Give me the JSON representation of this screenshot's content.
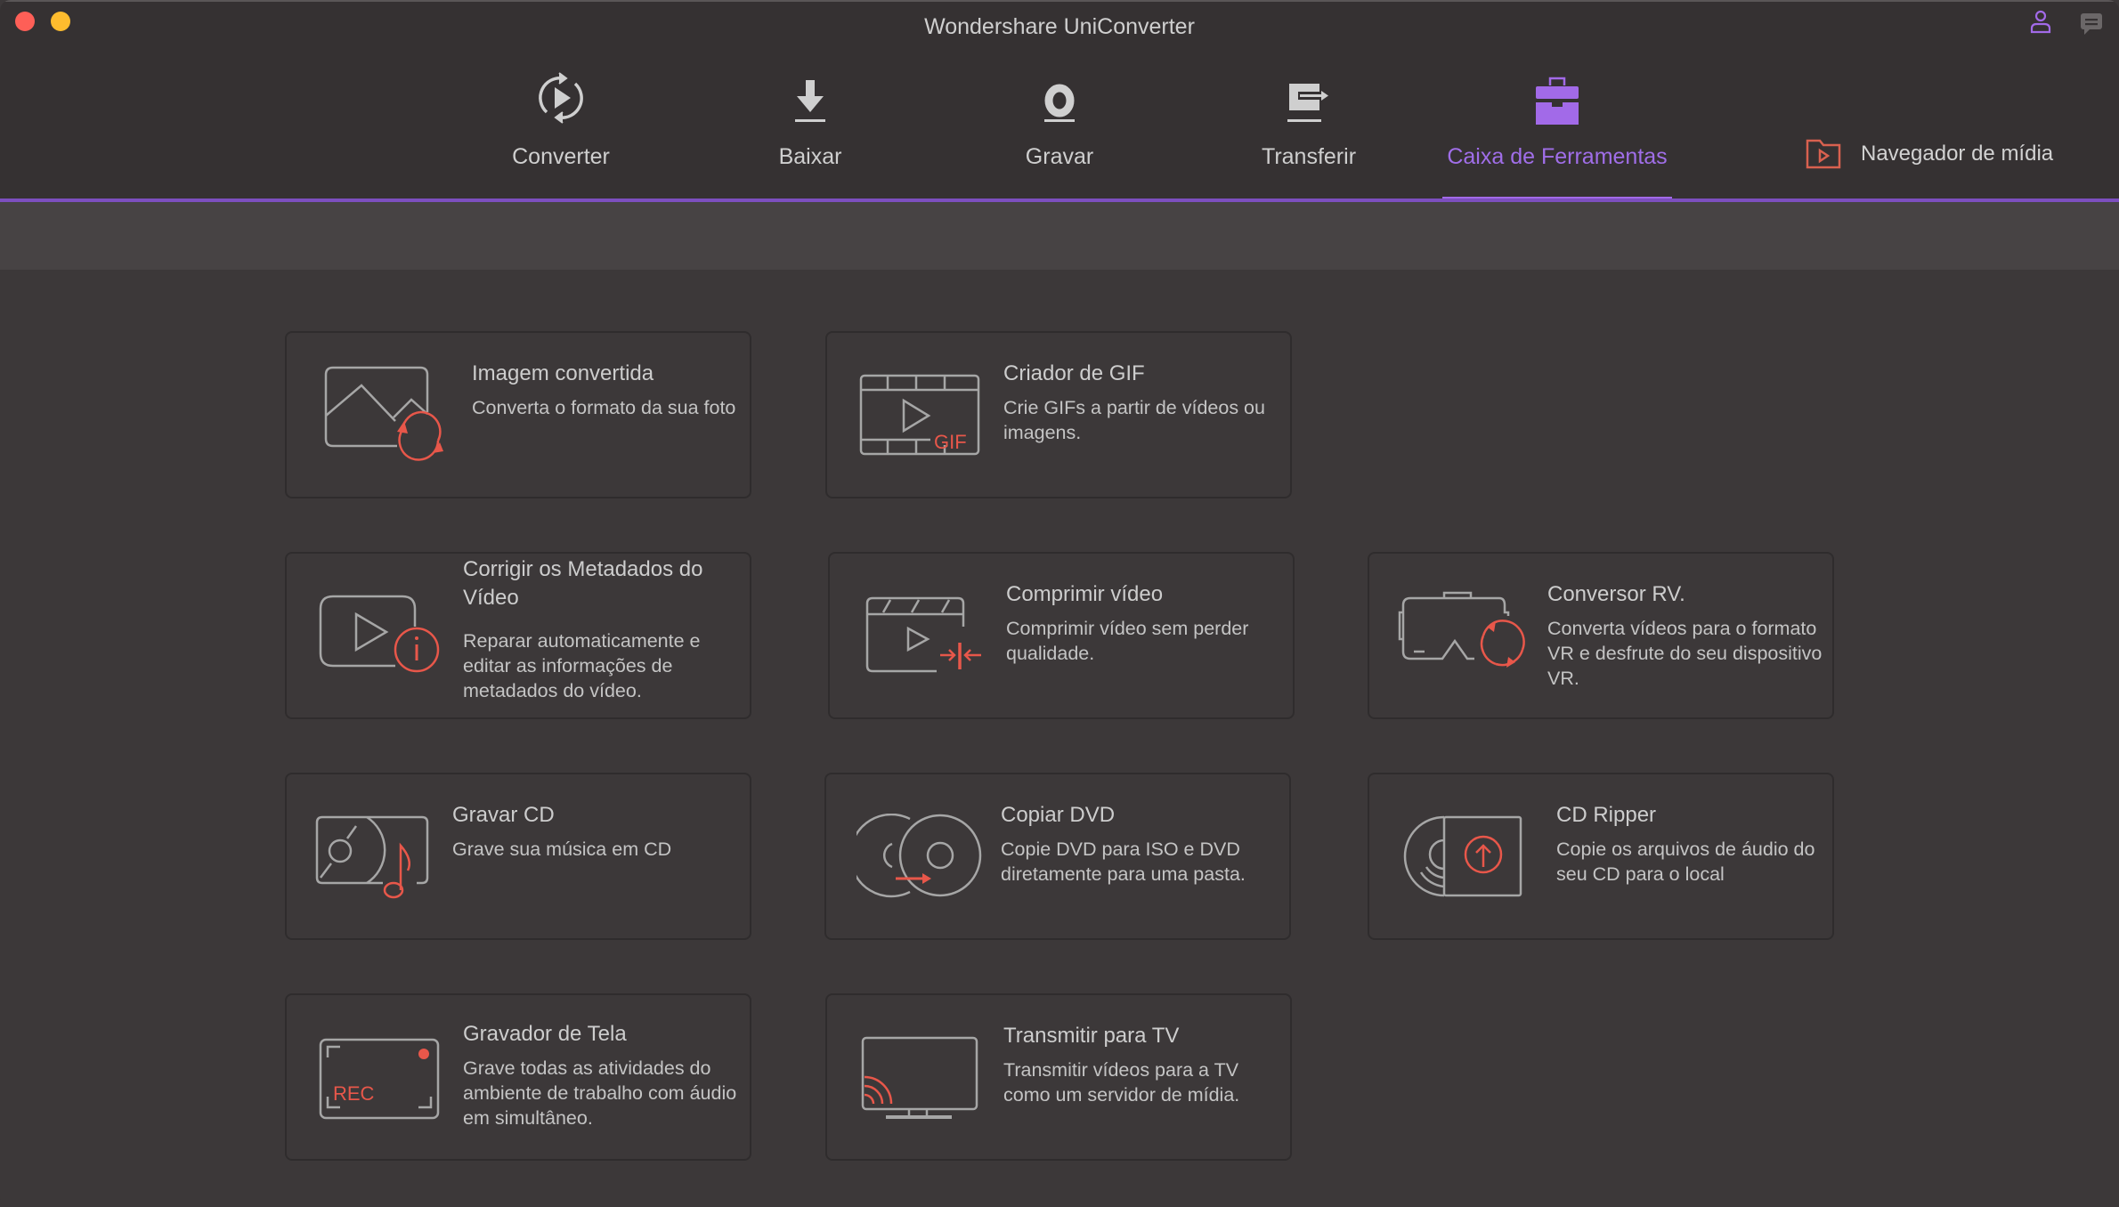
{
  "window": {
    "title": "Wondershare UniConverter",
    "controls": {
      "close": "close",
      "minimize": "minimize"
    }
  },
  "header_icons": {
    "account": "user-icon",
    "feedback": "chat-icon"
  },
  "nav": {
    "tabs": [
      {
        "label": "Converter",
        "icon": "convert-icon",
        "active": false
      },
      {
        "label": "Baixar",
        "icon": "download-icon",
        "active": false
      },
      {
        "label": "Gravar",
        "icon": "record-icon",
        "active": false
      },
      {
        "label": "Transferir",
        "icon": "transfer-icon",
        "active": false
      },
      {
        "label": "Caixa de Ferramentas",
        "icon": "toolbox-icon",
        "active": true
      }
    ],
    "media_browser": {
      "label": "Navegador de mídia",
      "icon": "media-folder-icon"
    }
  },
  "colors": {
    "accent": "#a26ae8",
    "accent_line": "#7d4fbf",
    "icon_red": "#e8574a",
    "background": "#3c3839",
    "topbar": "#353132"
  },
  "tools": [
    {
      "title": "Imagem convertida",
      "description": "Converta o formato da sua foto",
      "icon": "image-convert-icon"
    },
    {
      "title": "Criador de GIF",
      "description": "Crie GIFs a partir de vídeos ou imagens.",
      "icon": "gif-maker-icon",
      "icon_text": "GIF"
    },
    {
      "title": "Corrigir os Metadados do Vídeo",
      "description": "Reparar automaticamente e editar as informações de metadados do vídeo.",
      "icon": "video-metadata-icon"
    },
    {
      "title": "Comprimir vídeo",
      "description": "Comprimir vídeo sem perder qualidade.",
      "icon": "video-compress-icon"
    },
    {
      "title": "Conversor RV.",
      "description": "Converta vídeos para o formato VR e desfrute do seu dispositivo VR.",
      "icon": "vr-converter-icon"
    },
    {
      "title": "Gravar CD",
      "description": "Grave sua música em CD",
      "icon": "cd-burn-icon"
    },
    {
      "title": "Copiar DVD",
      "description": "Copie DVD para ISO e DVD diretamente para uma pasta.",
      "icon": "dvd-copy-icon"
    },
    {
      "title": "CD Ripper",
      "description": "Copie os arquivos de áudio do seu CD para o local",
      "icon": "cd-ripper-icon"
    },
    {
      "title": "Gravador de Tela",
      "description": "Grave todas as atividades do ambiente de trabalho com áudio em simultâneo.",
      "icon": "screen-recorder-icon",
      "icon_text": "REC"
    },
    {
      "title": "Transmitir para TV",
      "description": "Transmitir vídeos para a TV como um servidor de mídia.",
      "icon": "cast-tv-icon"
    }
  ]
}
